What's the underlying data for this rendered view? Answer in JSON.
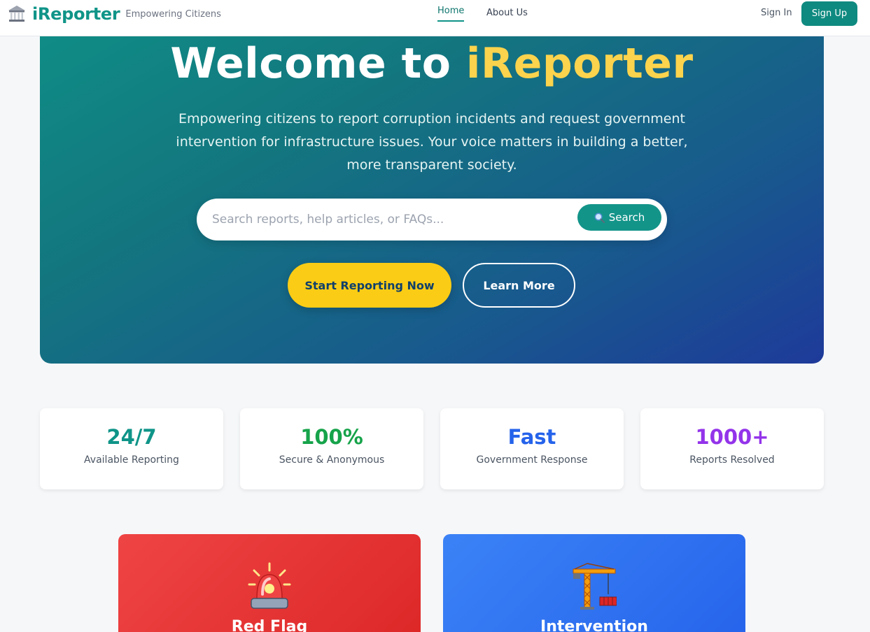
{
  "header": {
    "brand_name": "iReporter",
    "tagline": "Empowering Citizens",
    "nav": {
      "home": "Home",
      "about": "About Us"
    },
    "sign_in": "Sign In",
    "sign_up": "Sign Up",
    "brand_icon": "government-building-icon"
  },
  "hero": {
    "title_prefix": "Welcome to ",
    "title_accent": "iReporter",
    "subtitle": "Empowering citizens to report corruption incidents and request government intervention for infrastructure issues. Your voice matters in building a better, more transparent society.",
    "search": {
      "placeholder": "Search reports, help articles, or FAQs...",
      "value": "",
      "button_label": "Search",
      "button_icon": "search-icon"
    },
    "primary_cta": "Start Reporting Now",
    "secondary_cta": "Learn More"
  },
  "stats": [
    {
      "value": "24/7",
      "label": "Available Reporting",
      "color": "#0f9488"
    },
    {
      "value": "100%",
      "label": "Secure & Anonymous",
      "color": "#16a34a"
    },
    {
      "value": "Fast",
      "label": "Government Response",
      "color": "#2563eb"
    },
    {
      "value": "1000+",
      "label": "Reports Resolved",
      "color": "#9333ea"
    }
  ],
  "cards": [
    {
      "title": "Red Flag",
      "icon": "siren-icon",
      "color": "#ef4444"
    },
    {
      "title": "Intervention",
      "icon": "crane-icon",
      "color": "#3b82f6"
    }
  ],
  "colors": {
    "brand": "#0f9488",
    "accent_yellow": "#facc15",
    "hero_gradient_start": "#0f8f86",
    "hero_gradient_end": "#1e3a9a"
  }
}
